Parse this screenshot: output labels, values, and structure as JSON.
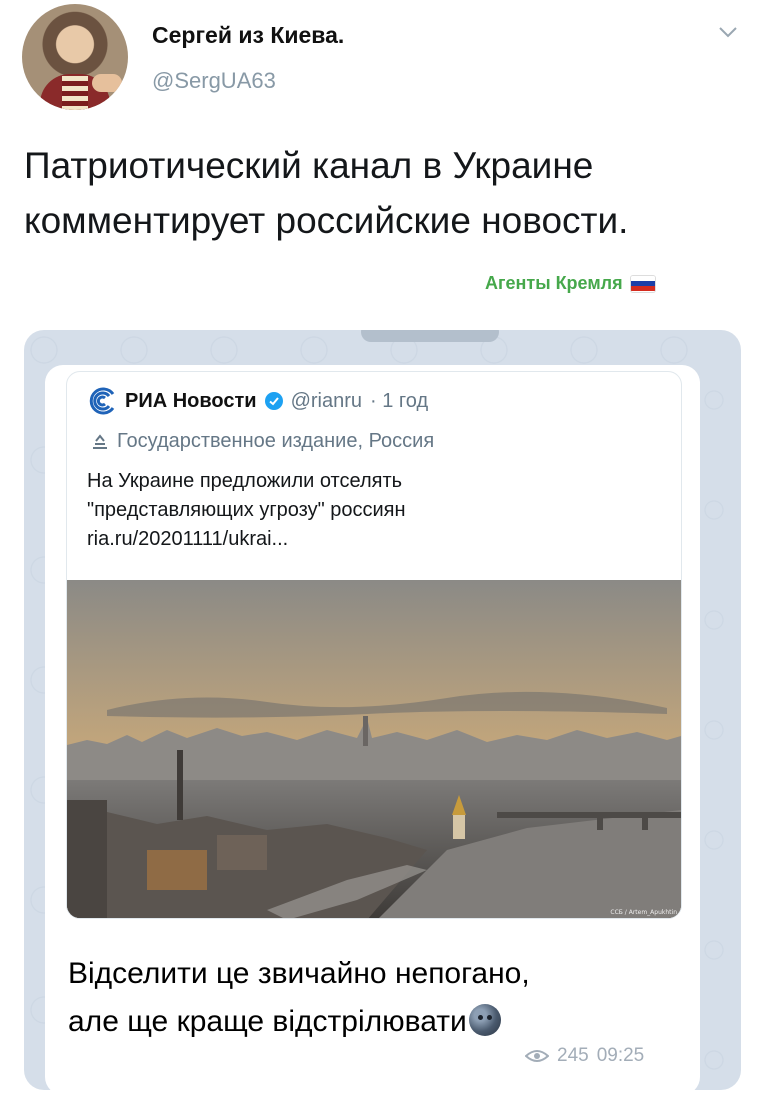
{
  "tweet": {
    "author_name": "Сергей из Киева.",
    "author_handle": "@SergUA63",
    "text": "Патриотический канал в Украине комментирует российские новости.",
    "tag_label": "Агенты Кремля",
    "menu_icon": "chevron-down-icon"
  },
  "embedded_tweet": {
    "account_name": "РИА Новости",
    "handle": "@rianru",
    "time": "· 1 год",
    "label": "Государственное издание, Россия",
    "text_line1": "На Украине предложили отселять",
    "text_line2": "\"представляющих угрозу\" россиян",
    "link": "ria.ru/20201111/ukrai...",
    "photo_credit": "ССБ / Artem_Apukhtin"
  },
  "telegram_message": {
    "text_line1": "Відселити це звичайно непогано,",
    "text_line2": "але ще краще відстрілювати",
    "views": "245",
    "time": "09:25"
  },
  "colors": {
    "tag_green": "#46a84b",
    "verified_blue": "#1da1f2",
    "telegram_bg": "#d5dee9",
    "secondary_text": "#657786"
  }
}
